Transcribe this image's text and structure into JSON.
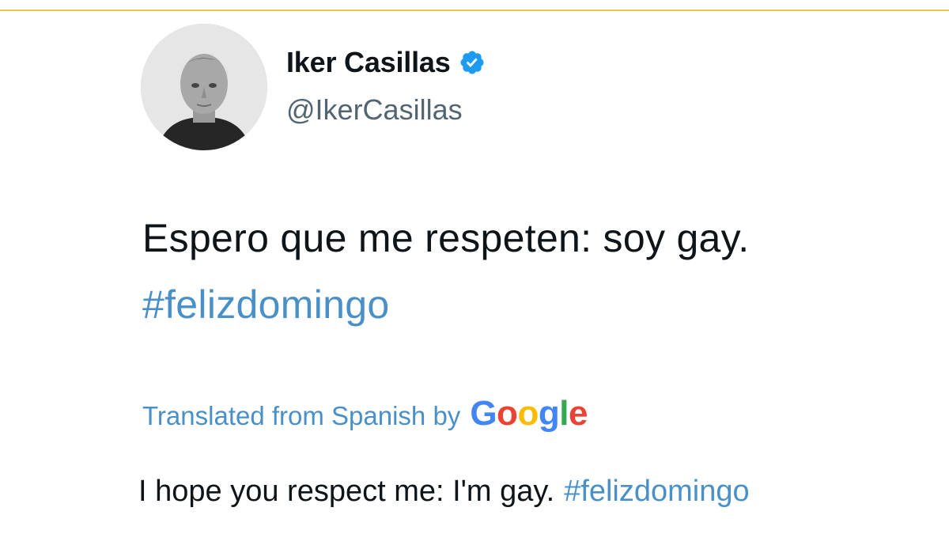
{
  "tweet": {
    "author": {
      "display_name": "Iker Casillas",
      "handle": "@IkerCasillas",
      "verified": true
    },
    "text": "Espero que me respeten: soy gay.",
    "hashtag": "#felizdomingo",
    "translation": {
      "label": "Translated from Spanish by",
      "provider": {
        "letters": [
          "G",
          "o",
          "o",
          "g",
          "l",
          "e"
        ]
      },
      "text": "I hope you respect me: I'm gay.",
      "hashtag": "#felizdomingo"
    }
  },
  "colors": {
    "accent_rule": "#e8c84a",
    "hashtag": "#4a90c8",
    "verified_badge": "#1d9bf0"
  },
  "icons": {
    "verified": "verified-badge-icon"
  }
}
